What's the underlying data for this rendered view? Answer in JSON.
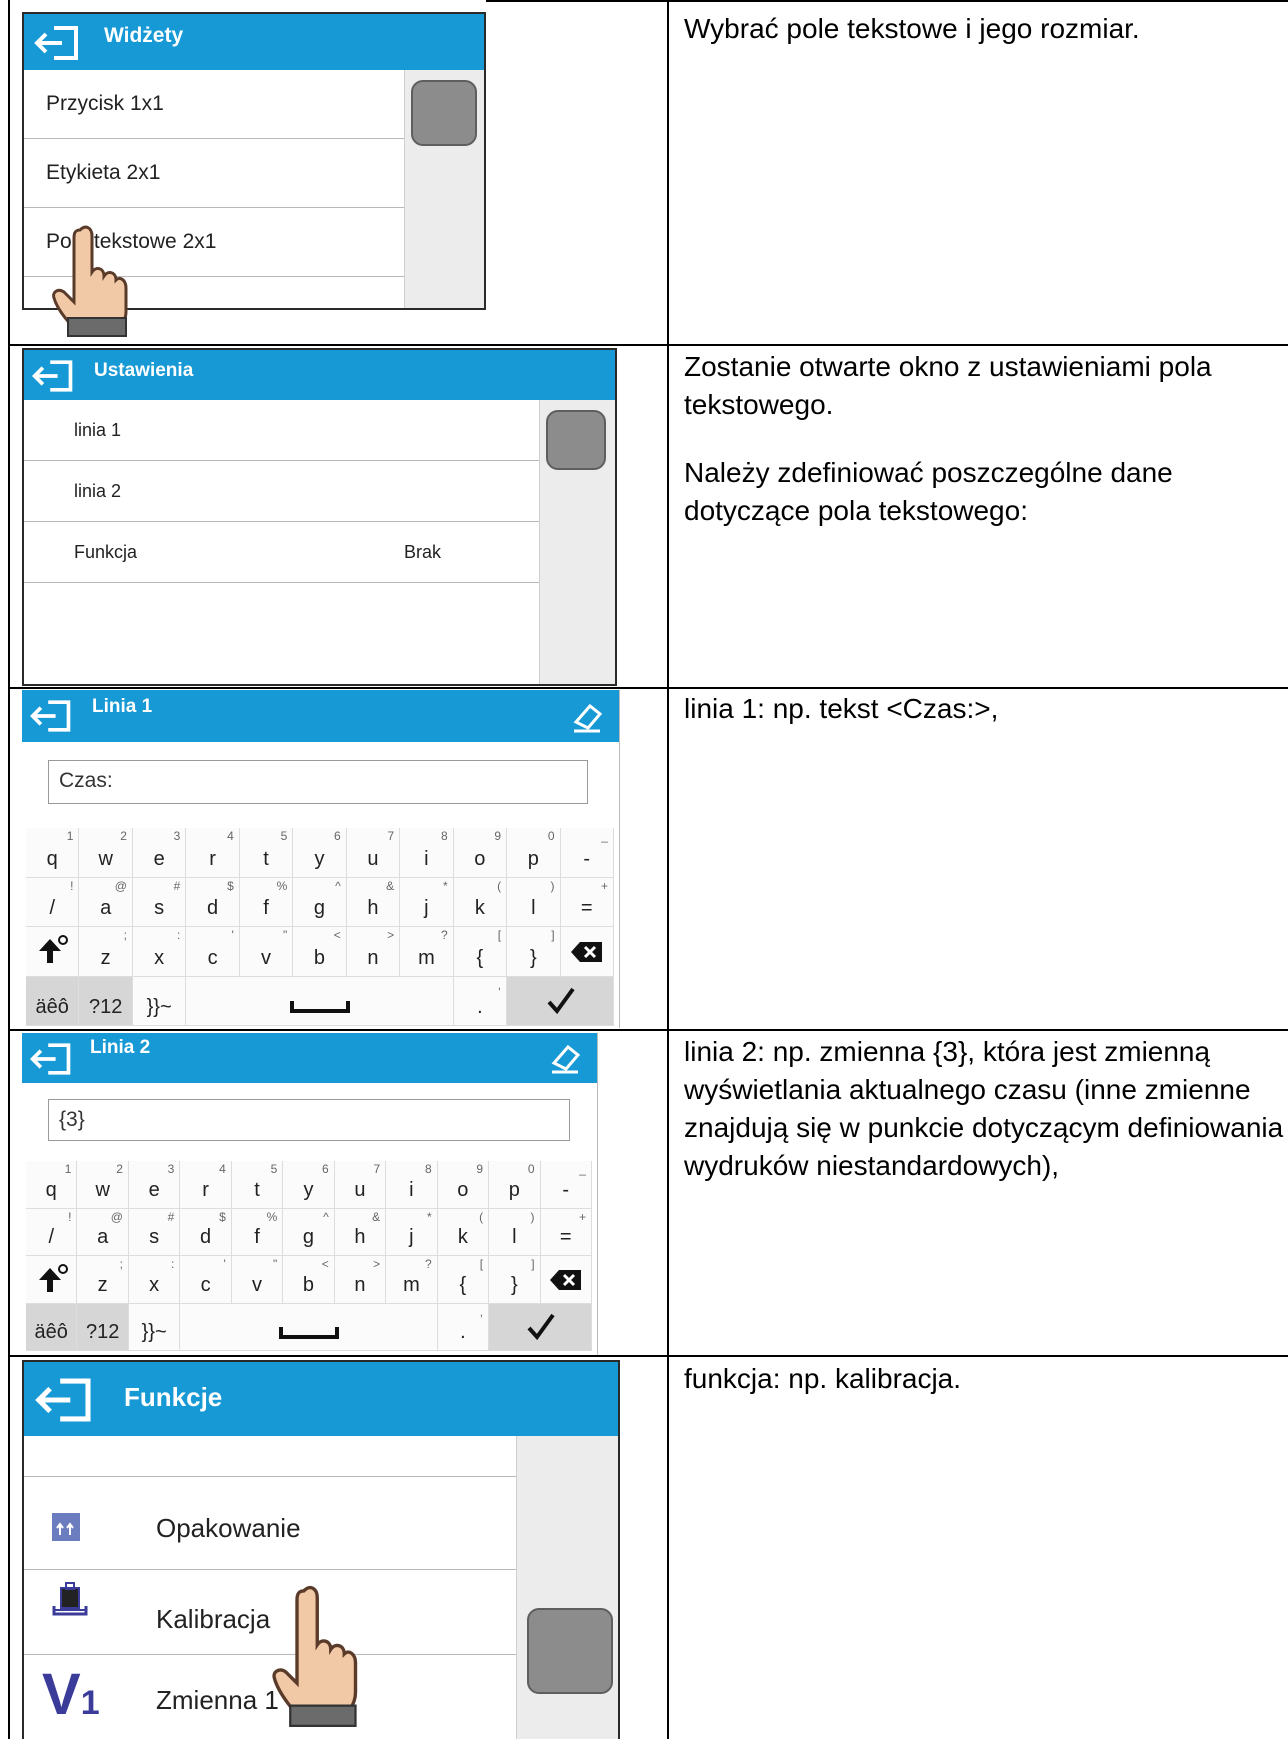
{
  "rows": [
    {
      "description": [
        "Wybrać pole tekstowe i jego rozmiar."
      ],
      "screen": {
        "title": "Widżety",
        "items": [
          "Przycisk 1x1",
          "Etykieta 2x1",
          "Pole tekstowe 2x1"
        ]
      }
    },
    {
      "description": [
        "Zostanie otwarte okno z ustawieniami pola tekstowego.",
        "Należy zdefiniować poszczególne dane dotyczące pola tekstowego:"
      ],
      "screen": {
        "title": "Ustawienia",
        "items": [
          {
            "label": "linia 1",
            "value": ""
          },
          {
            "label": "linia 2",
            "value": ""
          },
          {
            "label": "Funkcja",
            "value": "Brak"
          }
        ]
      }
    },
    {
      "description": [
        "linia 1: np. tekst <Czas:>,"
      ],
      "screen": {
        "title": "Linia 1",
        "input_value": "Czas:"
      }
    },
    {
      "description": [
        "linia 2: np. zmienna {3}, która jest zmienną wyświetlania aktualnego czasu (inne zmienne znajdują się w punkcie dotyczącym definiowania wydruków niestandardowych),"
      ],
      "screen": {
        "title": "Linia 2",
        "input_value": "{3}"
      }
    },
    {
      "description": [
        "funkcja: np. kalibracja."
      ],
      "screen": {
        "title": "Funkcje",
        "items": [
          "Opakowanie",
          "Kalibracja",
          "Zmienna 1"
        ]
      }
    }
  ],
  "keyboard": {
    "row1": [
      [
        "q",
        "1"
      ],
      [
        "w",
        "2"
      ],
      [
        "e",
        "3"
      ],
      [
        "r",
        "4"
      ],
      [
        "t",
        "5"
      ],
      [
        "y",
        "6"
      ],
      [
        "u",
        "7"
      ],
      [
        "i",
        "8"
      ],
      [
        "o",
        "9"
      ],
      [
        "p",
        "0"
      ],
      [
        "-",
        "_"
      ]
    ],
    "row2": [
      [
        "/",
        "!"
      ],
      [
        "a",
        "@"
      ],
      [
        "s",
        "#"
      ],
      [
        "d",
        "$"
      ],
      [
        "f",
        "%"
      ],
      [
        "g",
        "^"
      ],
      [
        "h",
        "&"
      ],
      [
        "j",
        "*"
      ],
      [
        "k",
        "("
      ],
      [
        "l",
        ")"
      ],
      [
        "=",
        "+"
      ]
    ],
    "row3": [
      [
        "z",
        ";"
      ],
      [
        "x",
        ":"
      ],
      [
        "c",
        "'"
      ],
      [
        "v",
        "\""
      ],
      [
        "b",
        "<"
      ],
      [
        "n",
        ">"
      ],
      [
        "m",
        "?"
      ],
      [
        "{",
        "["
      ],
      [
        "}",
        "]"
      ]
    ],
    "lang_key": "äêô",
    "num_key": "?12",
    "sym_key": "}}~",
    "dot_key": ".",
    "comma_sup": ","
  },
  "colors": {
    "header": "#1699d5",
    "thumb": "#8c8c8c"
  },
  "icons": [
    "back-arrow-icon",
    "eraser-icon",
    "hand-pointer-icon",
    "shift-icon",
    "backspace-icon",
    "checkmark-icon",
    "space-icon",
    "tare-icon",
    "calibration-icon",
    "variable-v1-icon"
  ]
}
